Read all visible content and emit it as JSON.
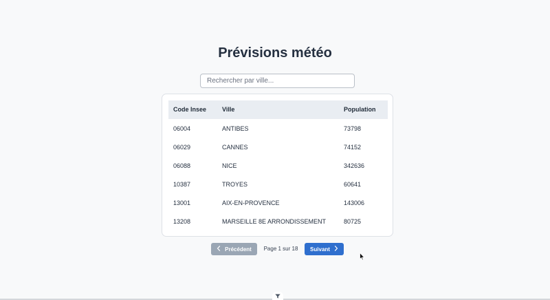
{
  "page": {
    "title": "Prévisions météo"
  },
  "search": {
    "placeholder": "Rechercher par ville...",
    "value": ""
  },
  "table": {
    "headers": [
      "Code Insee",
      "Ville",
      "Population"
    ],
    "rows": [
      [
        "06004",
        "ANTIBES",
        "73798"
      ],
      [
        "06029",
        "CANNES",
        "74152"
      ],
      [
        "06088",
        "NICE",
        "342636"
      ],
      [
        "10387",
        "TROYES",
        "60641"
      ],
      [
        "13001",
        "AIX-EN-PROVENCE",
        "143006"
      ],
      [
        "13208",
        "MARSEILLE 8E ARRONDISSEMENT",
        "80725"
      ]
    ]
  },
  "pagination": {
    "prev_label": "Précédent",
    "next_label": "Suivant",
    "page_info": "Page 1 sur 18",
    "prev_disabled": true
  },
  "colors": {
    "primary": "#2f6fce",
    "disabled": "#9aa6b4",
    "header_bg": "#e9edf2",
    "page_bg": "#f8f9fa"
  },
  "icons": {
    "prev": "chevron-left-icon",
    "next": "chevron-right-icon",
    "bottom": "filter-funnel-icon",
    "cursor": "mouse-pointer-icon"
  }
}
